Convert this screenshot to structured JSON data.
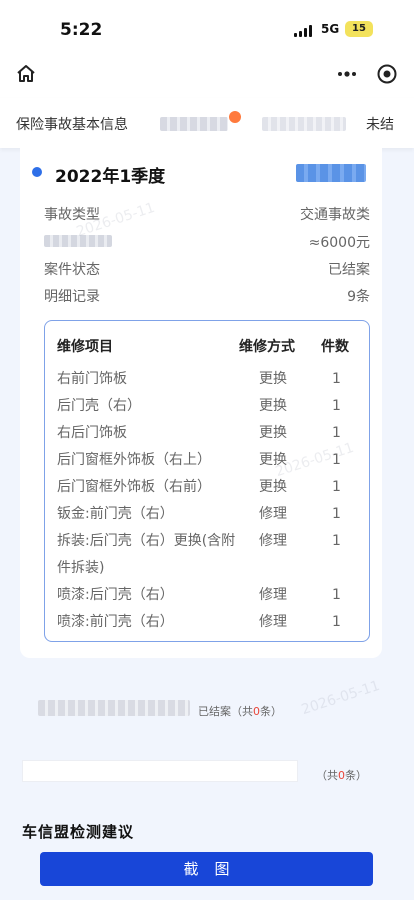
{
  "status_bar": {
    "time": "5:22",
    "network": "5G",
    "battery": "15"
  },
  "tabs": [
    {
      "label": "保险事故基本信息"
    },
    {
      "label": ""
    },
    {
      "label": ""
    },
    {
      "label": "未结"
    }
  ],
  "card": {
    "quarter_title": "2022年1季度",
    "info": [
      {
        "label": "事故类型",
        "value": "交通事故类"
      },
      {
        "label": "",
        "value": "≈6000元"
      },
      {
        "label": "案件状态",
        "value": "已结案"
      },
      {
        "label": "明细记录",
        "value": "9条"
      }
    ],
    "repair_table": {
      "headers": {
        "item": "维修项目",
        "method": "维修方式",
        "qty": "件数"
      },
      "rows": [
        {
          "item": "右前门饰板",
          "method": "更换",
          "qty": "1"
        },
        {
          "item": "后门壳（右）",
          "method": "更换",
          "qty": "1"
        },
        {
          "item": "右后门饰板",
          "method": "更换",
          "qty": "1"
        },
        {
          "item": "后门窗框外饰板（右上）",
          "method": "更换",
          "qty": "1"
        },
        {
          "item": "后门窗框外饰板（右前）",
          "method": "更换",
          "qty": "1"
        },
        {
          "item": "钣金:前门壳（右）",
          "method": "修理",
          "qty": "1"
        },
        {
          "item": "拆装:后门壳（右）更换(含附件拆装)",
          "method": "修理",
          "qty": "1"
        },
        {
          "item": "喷漆:后门壳（右）",
          "method": "修理",
          "qty": "1"
        },
        {
          "item": "喷漆:前门壳（右）",
          "method": "修理",
          "qty": "1"
        }
      ]
    }
  },
  "records": {
    "record_1_status": "已结案（共",
    "record_1_count": "0",
    "record_1_suffix": "条）",
    "record_2_prefix": "（共",
    "record_2_count": "0",
    "record_2_suffix": "条）"
  },
  "watermark": "2026-05-11",
  "section_title": "车信盟检测建议",
  "screenshot_button": "截图",
  "colors": {
    "accent": "#1846d8",
    "dot": "#2e6fe8",
    "table_border": "#7fa2e8",
    "count_red": "#e8463a"
  }
}
